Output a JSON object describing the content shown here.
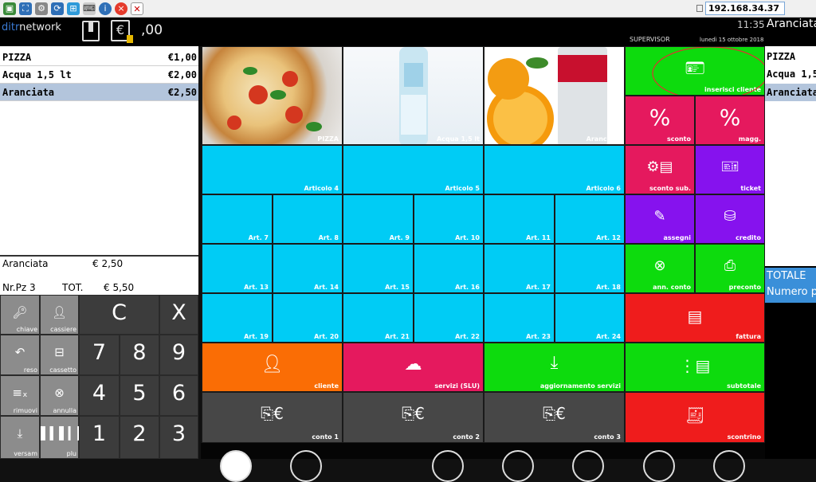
{
  "ip_address": "192.168.34.37",
  "header": {
    "logo_prefix": "ditr",
    "logo_suffix": "network",
    "amount": ",00",
    "clock": "11:35",
    "current_product": "Aranciata",
    "user": "SUPERVISOR",
    "date": "lunedì 15 ottobre 2018"
  },
  "receipt": {
    "items": [
      {
        "name": "PIZZA",
        "price": "€1,00"
      },
      {
        "name": "Acqua 1,5 lt",
        "price": "€2,00"
      },
      {
        "name": "Aranciata",
        "price": "€2,50"
      }
    ],
    "selected_name": "Aranciata",
    "selected_price": "€ 2,50",
    "pieces_label": "Nr.Pz 3",
    "total_label": "TOT.",
    "total_value": "€ 5,50"
  },
  "keypad": {
    "func_keys": [
      "chiave",
      "cassiere",
      "reso",
      "cassetto",
      "rimuovi",
      "annulla",
      "versam",
      "plu"
    ],
    "clear": "C",
    "cancel": "X",
    "digits": [
      "7",
      "8",
      "9",
      "4",
      "5",
      "6",
      "1",
      "2",
      "3"
    ]
  },
  "products": [
    {
      "label": "PIZZA"
    },
    {
      "label": "Acqua 1,5 lt"
    },
    {
      "label": "Aranciata"
    }
  ],
  "articles_large": [
    "Articolo 4",
    "Articolo 5",
    "Articolo 6"
  ],
  "articles_small": [
    "Art. 7",
    "Art. 8",
    "Art. 9",
    "Art. 10",
    "Art. 11",
    "Art. 12",
    "Art. 13",
    "Art. 14",
    "Art. 15",
    "Art. 16",
    "Art. 17",
    "Art. 18",
    "Art. 19",
    "Art. 20",
    "Art. 21",
    "Art. 22",
    "Art. 23",
    "Art. 24"
  ],
  "functions": {
    "inserisci_cliente": "inserisci cliente",
    "sconto": "sconto",
    "magg": "magg.",
    "sconto_sub": "sconto sub.",
    "ticket": "ticket",
    "assegni": "assegni",
    "credito": "credito",
    "ann_conto": "ann. conto",
    "preconto": "preconto",
    "fattura": "fattura",
    "cliente": "cliente",
    "servizi": "servizi (SLU)",
    "aggiornamento": "aggiornamento servizi",
    "subtotale": "subtotale",
    "conto1": "conto 1",
    "conto2": "conto 2",
    "conto3": "conto 3",
    "scontrino": "scontrino",
    "percent_symbol": "%"
  },
  "right_panel": {
    "items": [
      "PIZZA",
      "Acqua 1,5",
      "Aranciata"
    ],
    "total_label": "TOTALE",
    "count_label": "Numero p"
  },
  "colors": {
    "cyan": "#00ccf5",
    "green": "#0ddb0d",
    "red": "#ef1c1c",
    "pink": "#e5195e",
    "purple": "#8612ee",
    "orange": "#fa6d05",
    "gray": "#474747",
    "receipt_selected": "#b3c5dc"
  }
}
